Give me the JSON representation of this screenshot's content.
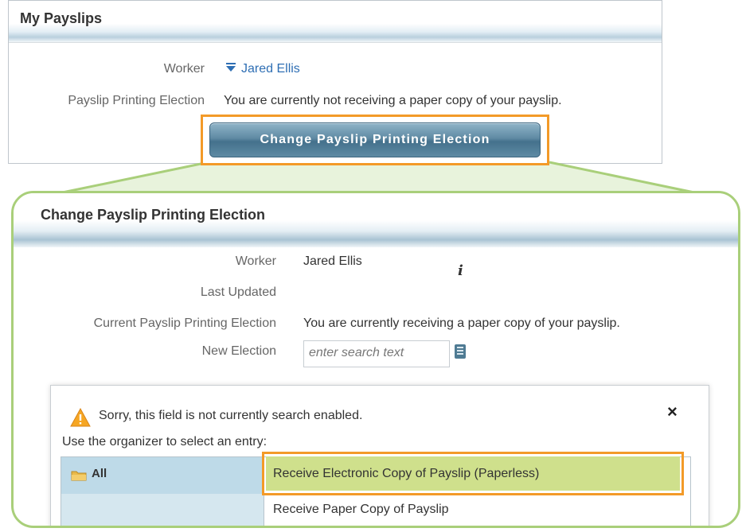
{
  "top": {
    "title": "My Payslips",
    "worker_label": "Worker",
    "worker_value": "Jared Ellis",
    "election_label": "Payslip Printing Election",
    "election_value": "You are currently not receiving a paper copy of your payslip.",
    "change_button": "Change Payslip Printing Election"
  },
  "detail": {
    "title": "Change Payslip Printing Election",
    "worker_label": "Worker",
    "worker_value": "Jared Ellis",
    "info_glyph": "i",
    "last_updated_label": "Last Updated",
    "current_label": "Current Payslip Printing Election",
    "current_value": "You are currently receiving a paper copy of your payslip.",
    "new_label": "New Election",
    "search_placeholder": "enter search text"
  },
  "popup": {
    "warning": "Sorry, this field is not currently search enabled.",
    "hint": "Use the organizer to select an entry:",
    "close_glyph": "×",
    "category": "All",
    "options": [
      "Receive Electronic Copy of Payslip (Paperless)",
      "Receive Paper Copy of Payslip"
    ],
    "selected_option_index": 0
  },
  "colors": {
    "highlight_orange": "#f39a28",
    "callout_green": "#a9cf7a",
    "selected_option_bg": "#cfe08c",
    "link_blue": "#2f6fb4",
    "button_blue": "#44718c"
  }
}
